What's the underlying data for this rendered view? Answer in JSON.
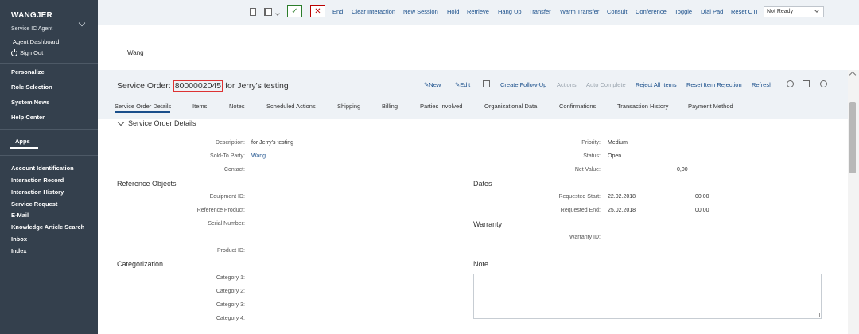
{
  "sidebar": {
    "user": "WANGJER",
    "role": "Service IC Agent",
    "dashboard": "Agent Dashboard",
    "signout": "Sign Out",
    "menu": [
      "Personalize",
      "Role Selection",
      "System News",
      "Help Center"
    ],
    "apps_label": "Apps",
    "apps": [
      "Account Identification",
      "Interaction Record",
      "Interaction History",
      "Service Request",
      "E-Mail",
      "Knowledge Article Search",
      "Inbox",
      "Index"
    ]
  },
  "toolbar": {
    "actions": [
      "End",
      "Clear Interaction",
      "New Session",
      "Hold",
      "Retrieve",
      "Hang Up",
      "Transfer",
      "Warm Transfer",
      "Consult",
      "Conference",
      "Toggle",
      "Dial Pad",
      "Reset CTI"
    ],
    "accept": "✓",
    "reject": "✕",
    "status": "Not Ready"
  },
  "banner": {
    "name": "Wang"
  },
  "header": {
    "title_prefix": "Service Order:",
    "order_id": "8000002045",
    "title_suffix": "for Jerry's testing",
    "actions": {
      "new": "New",
      "edit": "Edit",
      "create_follow_up": "Create Follow-Up",
      "actions": "Actions",
      "auto_complete": "Auto Complete",
      "reject_all": "Reject All Items",
      "reset_rejection": "Reset Item Rejection",
      "refresh": "Refresh"
    },
    "tabs": [
      "Service Order Details",
      "Items",
      "Notes",
      "Scheduled Actions",
      "Shipping",
      "Billing",
      "Parties Involved",
      "Organizational Data",
      "Confirmations",
      "Transaction History",
      "Payment Method"
    ]
  },
  "details": {
    "section": "Service Order Details",
    "description_label": "Description:",
    "description": "for Jerry's testing",
    "sold_to_label": "Sold-To Party:",
    "sold_to": "Wang",
    "contact_label": "Contact:",
    "priority_label": "Priority:",
    "priority": "Medium",
    "status_label": "Status:",
    "status": "Open",
    "net_value_label": "Net Value:",
    "net_value": "0,00"
  },
  "reference": {
    "title": "Reference Objects",
    "equipment_label": "Equipment ID:",
    "product_label": "Reference Product:",
    "serial_label": "Serial Number:",
    "product_id_label": "Product ID:"
  },
  "dates": {
    "title": "Dates",
    "start_label": "Requested Start:",
    "start_date": "22.02.2018",
    "start_time": "00:00",
    "end_label": "Requested End:",
    "end_date": "25.02.2018",
    "end_time": "00:00"
  },
  "warranty": {
    "title": "Warranty",
    "id_label": "Warranty ID:"
  },
  "categorization": {
    "title": "Categorization",
    "cat1": "Category 1:",
    "cat2": "Category 2:",
    "cat3": "Category 3:",
    "cat4": "Category 4:"
  },
  "note": {
    "title": "Note"
  }
}
